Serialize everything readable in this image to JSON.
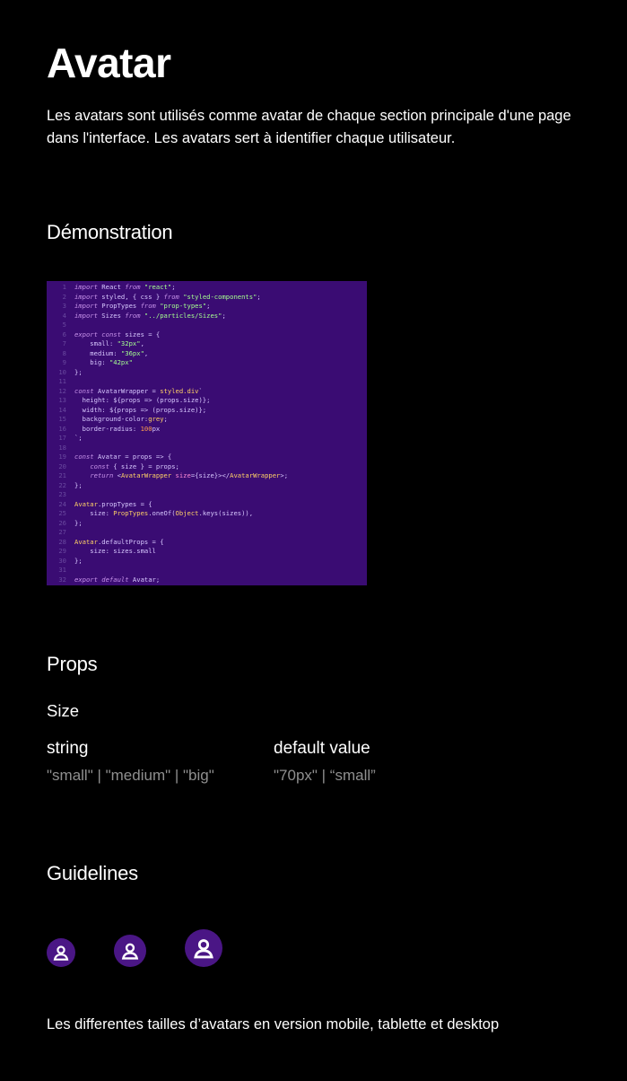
{
  "page": {
    "title": "Avatar",
    "intro": "Les avatars sont utilisés comme avatar de chaque section principale d'une page dans l'interface. Les avatars sert à identifier chaque utilisateur."
  },
  "demo": {
    "heading": "Démonstration",
    "code_lines": [
      {
        "n": "1",
        "html": "<span class=\"kw\">import</span> React <span class=\"kw\">from</span> <span class=\"str\">\"react\"</span>;"
      },
      {
        "n": "2",
        "html": "<span class=\"kw\">import</span> styled, { css } <span class=\"kw\">from</span> <span class=\"str\">\"styled-components\"</span>;"
      },
      {
        "n": "3",
        "html": "<span class=\"kw\">import</span> PropTypes <span class=\"kw\">from</span> <span class=\"str\">\"prop-types\"</span>;"
      },
      {
        "n": "4",
        "html": "<span class=\"kw\">import</span> Sizes <span class=\"kw\">from</span> <span class=\"str\">\"../particles/Sizes\"</span>;"
      },
      {
        "n": "5",
        "html": ""
      },
      {
        "n": "6",
        "html": "<span class=\"kw\">export const</span> sizes = {"
      },
      {
        "n": "7",
        "html": "    small: <span class=\"str\">\"32px\"</span>,"
      },
      {
        "n": "8",
        "html": "    medium: <span class=\"str\">\"36px\"</span>,"
      },
      {
        "n": "9",
        "html": "    big: <span class=\"str\">\"42px\"</span>"
      },
      {
        "n": "10",
        "html": "};"
      },
      {
        "n": "11",
        "html": ""
      },
      {
        "n": "12",
        "html": "<span class=\"kw\">const</span> AvatarWrapper = <span class=\"fn\">styled.div</span>`"
      },
      {
        "n": "13",
        "html": "  height: ${props => (props.size)};"
      },
      {
        "n": "14",
        "html": "  width: ${props => (props.size)};"
      },
      {
        "n": "15",
        "html": "  background-color:<span class=\"fn\">grey</span>;"
      },
      {
        "n": "16",
        "html": "  border-radius: <span class=\"num\">100</span>px"
      },
      {
        "n": "17",
        "html": "`;"
      },
      {
        "n": "18",
        "html": ""
      },
      {
        "n": "19",
        "html": "<span class=\"kw\">const</span> Avatar = props => {"
      },
      {
        "n": "20",
        "html": "    <span class=\"kw\">const</span> { size } = props;"
      },
      {
        "n": "21",
        "html": "    <span class=\"kw\">return</span> &lt;<span class=\"fn\">AvatarWrapper</span> <span class=\"tag\">size</span>={size}&gt;&lt;/<span class=\"fn\">AvatarWrapper</span>&gt;;"
      },
      {
        "n": "22",
        "html": "};"
      },
      {
        "n": "23",
        "html": ""
      },
      {
        "n": "24",
        "html": "<span class=\"fn\">Avatar</span>.propTypes = {"
      },
      {
        "n": "25",
        "html": "    size: <span class=\"fn\">PropTypes</span>.oneOf(<span class=\"fn\">Object</span>.keys(sizes)),"
      },
      {
        "n": "26",
        "html": "};"
      },
      {
        "n": "27",
        "html": ""
      },
      {
        "n": "28",
        "html": "<span class=\"fn\">Avatar</span>.defaultProps = {"
      },
      {
        "n": "29",
        "html": "    size: sizes.small"
      },
      {
        "n": "30",
        "html": "};"
      },
      {
        "n": "31",
        "html": ""
      },
      {
        "n": "32",
        "html": "<span class=\"kw\">export default</span> Avatar;"
      }
    ]
  },
  "props": {
    "heading": "Props",
    "name": "Size",
    "type_label": "string",
    "type_value": "\"small\" | \"medium\" | \"big\"",
    "default_label": "default value",
    "default_value": "\"70px\" | “small”"
  },
  "guidelines": {
    "heading": "Guidelines",
    "avatars": [
      {
        "icon": "user-icon",
        "variant": "mobile"
      },
      {
        "icon": "user-icon",
        "variant": "tablette"
      },
      {
        "icon": "user-icon",
        "variant": "desktop"
      }
    ],
    "caption": "Les differentes tailles d’avatars en version mobile, tablette et desktop"
  },
  "colors": {
    "background": "#000000",
    "text": "#ffffff",
    "muted_text": "#8f8f8f",
    "code_background": "#3a0c73",
    "avatar_background": "#4a1685"
  }
}
